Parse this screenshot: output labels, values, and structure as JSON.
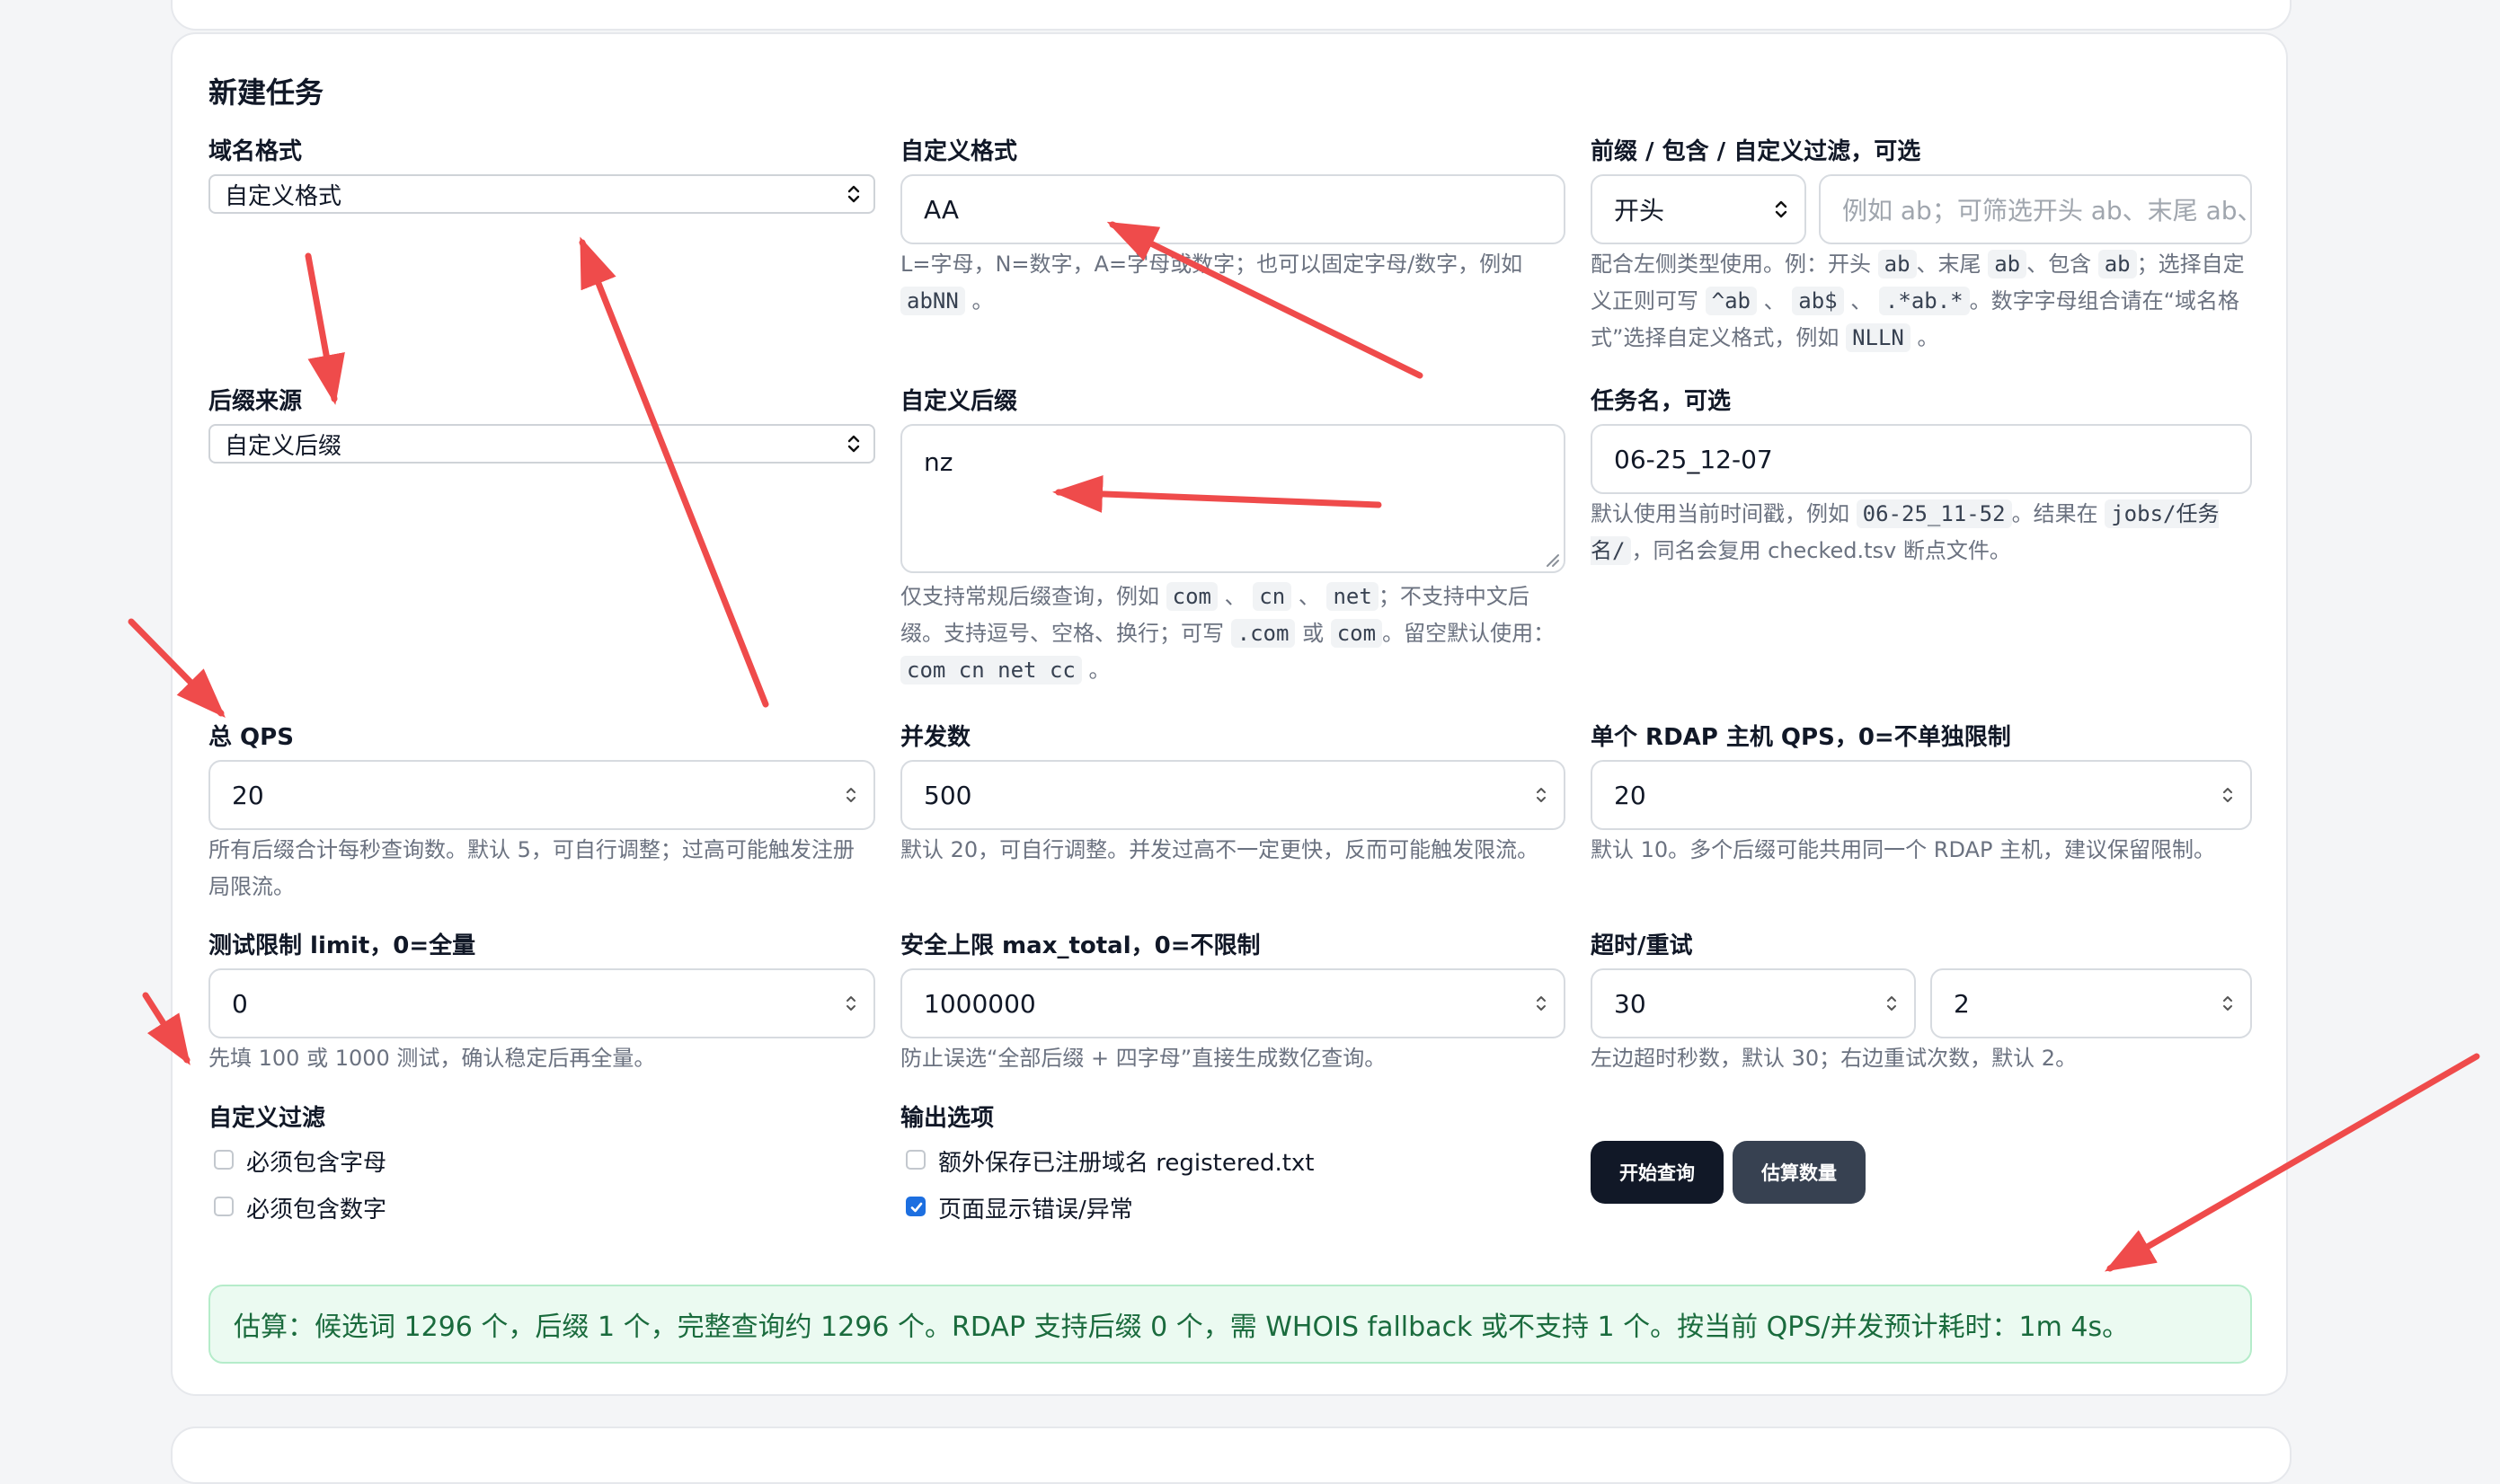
{
  "section_title": "新建任务",
  "col1": {
    "domain_format": {
      "label": "域名格式",
      "value": "自定义格式"
    },
    "suffix_source": {
      "label": "后缀来源",
      "value": "自定义后缀"
    },
    "total_qps": {
      "label": "总 QPS",
      "value": "20",
      "help": "所有后缀合计每秒查询数。默认 5，可自行调整；过高可能触发注册局限流。"
    },
    "test_limit": {
      "label": "测试限制 limit，0=全量",
      "value": "0",
      "help": "先填 100 或 1000 测试，确认稳定后再全量。"
    },
    "custom_filter": {
      "label": "自定义过滤",
      "must_letter": "必须包含字母",
      "must_digit": "必须包含数字"
    }
  },
  "col2": {
    "custom_format": {
      "label": "自定义格式",
      "value": "AA",
      "help_1": "L=字母，N=数字，A=字母或数字；也可以固定字母/数字，例如",
      "help_code": "abNN",
      "help_end": "。"
    },
    "custom_suffix": {
      "label": "自定义后缀",
      "value": "nz",
      "help_1": "仅支持常规后缀查询，例如",
      "code_com": "com",
      "sep1": "、",
      "code_cn": "cn",
      "sep2": "、",
      "code_net": "net",
      "help_2": "；不支持中文后缀。支持逗号、空格、换行；可写",
      "code_dotcom": ".com",
      "help_or": "或",
      "code_com2": "com",
      "help_3": "。留空默认使用：",
      "code_default": "com cn net cc",
      "help_end": "。"
    },
    "concurrency": {
      "label": "并发数",
      "value": "500",
      "help": "默认 20，可自行调整。并发过高不一定更快，反而可能触发限流。"
    },
    "max_total": {
      "label": "安全上限 max_total，0=不限制",
      "value": "1000000",
      "help": "防止误选“全部后缀 + 四字母”直接生成数亿查询。"
    },
    "output_options": {
      "label": "输出选项",
      "save_registered": "额外保存已注册域名 registered.txt",
      "show_errors": "页面显示错误/异常"
    }
  },
  "col3": {
    "prefix_filter": {
      "label": "前缀 / 包含 / 自定义过滤，可选",
      "mode_value": "开头",
      "placeholder": "例如 ab；可筛选开头 ab、末尾 ab、包含 ab",
      "help_1": "配合左侧类型使用。例：开头",
      "code_ab1": "ab",
      "help_2": "、末尾",
      "code_ab2": "ab",
      "help_3": "、包含",
      "code_ab3": "ab",
      "help_4": "；选择自定义正则可写",
      "code_re1": "^ab",
      "sep1": "、",
      "code_re2": "ab$",
      "sep2": "、",
      "code_re3": ".*ab.*",
      "help_5": "。数字字母组合请在“域名格式”选择自定义格式，例如",
      "code_nlln": "NLLN",
      "help_end": "。"
    },
    "task_name": {
      "label": "任务名，可选",
      "value": "06-25_12-07",
      "help_1": "默认使用当前时间戳，例如",
      "code_ts": "06-25_11-52",
      "help_2": "。结果在",
      "code_path": "jobs/任务名/",
      "help_3": "，同名会复用 checked.tsv 断点文件。"
    },
    "rdap_qps": {
      "label": "单个 RDAP 主机 QPS，0=不单独限制",
      "value": "20",
      "help": "默认 10。多个后缀可能共用同一个 RDAP 主机，建议保留限制。"
    },
    "timeout_retry": {
      "label": "超时/重试",
      "timeout_value": "30",
      "retry_value": "2",
      "help": "左边超时秒数，默认 30；右边重试次数，默认 2。"
    }
  },
  "buttons": {
    "start": "开始查询",
    "estimate": "估算数量"
  },
  "estimate_text": "估算：候选词 1296 个，后缀 1 个，完整查询约 1296 个。RDAP 支持后缀 0 个，需 WHOIS fallback 或不支持 1 个。按当前 QPS/并发预计耗时：1m 4s。",
  "colors": {
    "primary_button": "#111827",
    "secondary_button": "#374151",
    "annotation_arrow": "#ef4b4b",
    "estimate_bg": "#ebfaf1",
    "checkbox_checked": "#1d6fe0"
  }
}
